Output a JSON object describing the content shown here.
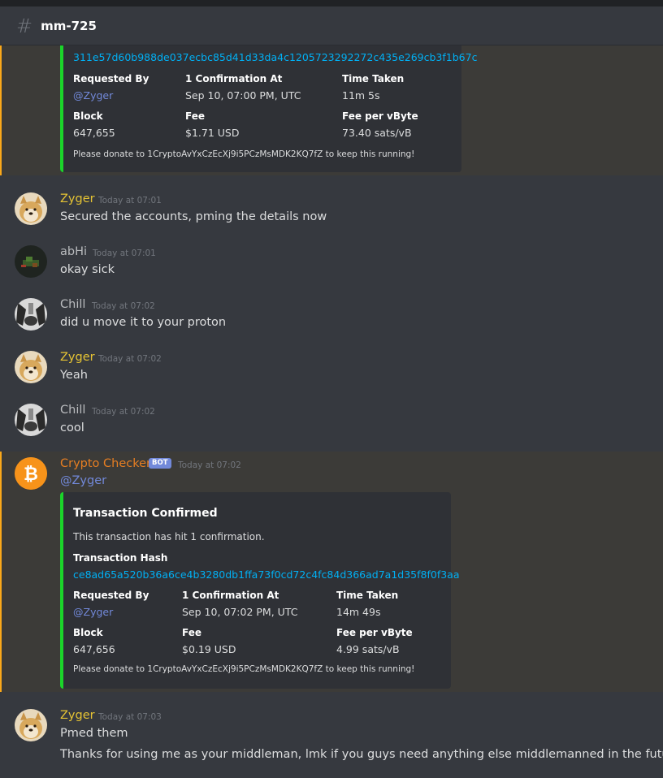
{
  "channel": {
    "name": "mm-725",
    "icon": "hash-icon"
  },
  "colors": {
    "zyger": "#e5c334",
    "gray_user": "#b9bbbe",
    "crypto": "#e67e22",
    "embed_bar": "#1bd42a",
    "link": "#00b0f4",
    "mention": "#7289da"
  },
  "embed1": {
    "hash": "311e57d60b988de037ecbc85d41d33da4c1205723292272c435e269cb3f1b67c",
    "requested_by_label": "Requested By",
    "requested_by_value": "@Zyger",
    "confirmation_label": "1 Confirmation At",
    "confirmation_value": "Sep 10, 07:00 PM, UTC",
    "time_taken_label": "Time Taken",
    "time_taken_value": "11m 5s",
    "block_label": "Block",
    "block_value": "647,655",
    "fee_label": "Fee",
    "fee_value": "$1.71 USD",
    "fee_per_vbyte_label": "Fee per vByte",
    "fee_per_vbyte_value": "73.40 sats/vB",
    "footer": "Please donate to 1CryptoAvYxCzEcXj9i5PCzMsMDK2KQ7fZ to keep this running!"
  },
  "messages": [
    {
      "user": "Zyger",
      "timestamp": "Today at 07:01",
      "text": "Secured the accounts, pming the details now",
      "avatar": "doge-avatar"
    },
    {
      "user": "abHi",
      "timestamp": "Today at 07:01",
      "text": "okay sick",
      "avatar": "minecraft-avatar"
    },
    {
      "user": "Chill",
      "timestamp": "Today at 07:02",
      "text": "did u move it to your proton",
      "avatar": "raccoon-avatar"
    },
    {
      "user": "Zyger",
      "timestamp": "Today at 07:02",
      "text": "Yeah",
      "avatar": "doge-avatar"
    },
    {
      "user": "Chill",
      "timestamp": "Today at 07:02",
      "text": "cool",
      "avatar": "raccoon-avatar"
    }
  ],
  "bot_message": {
    "user": "Crypto Checker",
    "badge": "BOT",
    "timestamp": "Today at 07:02",
    "mention": "@Zyger",
    "avatar": "bitcoin-icon"
  },
  "embed2": {
    "title": "Transaction Confirmed",
    "description": "This transaction has hit 1 confirmation.",
    "hash_label": "Transaction Hash",
    "hash": "ce8ad65a520b36a6ce4b3280db1ffa73f0cd72c4fc84d366ad7a1d35f8f0f3aa",
    "requested_by_label": "Requested By",
    "requested_by_value": "@Zyger",
    "confirmation_label": "1 Confirmation At",
    "confirmation_value": "Sep 10, 07:02 PM, UTC",
    "time_taken_label": "Time Taken",
    "time_taken_value": "14m 49s",
    "block_label": "Block",
    "block_value": "647,656",
    "fee_label": "Fee",
    "fee_value": "$0.19 USD",
    "fee_per_vbyte_label": "Fee per vByte",
    "fee_per_vbyte_value": "4.99 sats/vB",
    "footer": "Please donate to 1CryptoAvYxCzEcXj9i5PCzMsMDK2KQ7fZ to keep this running!"
  },
  "last_message": {
    "user": "Zyger",
    "timestamp": "Today at 07:03",
    "lines": [
      "Pmed them",
      "Thanks for using me as your middleman, lmk if you guys need anything else middlemanned in the future (:"
    ],
    "avatar": "doge-avatar"
  }
}
